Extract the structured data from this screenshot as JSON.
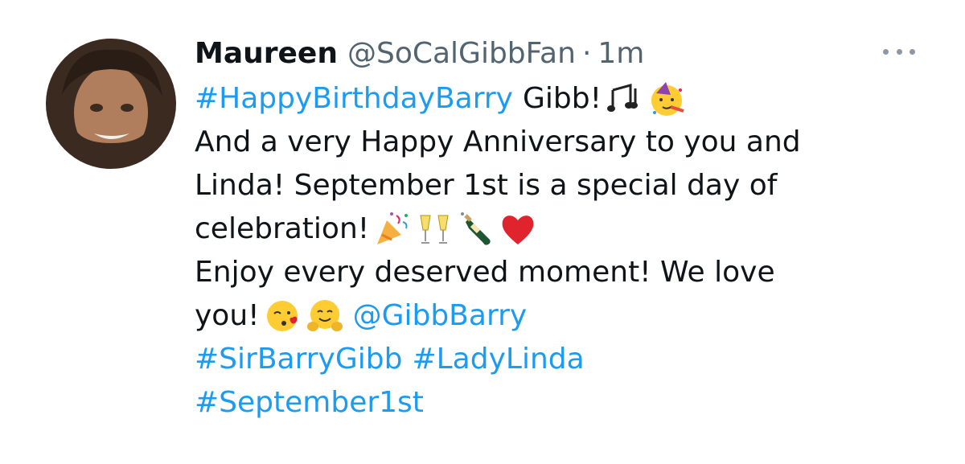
{
  "author": {
    "display_name": "Maureen",
    "handle": "@SoCalGibbFan",
    "separator": "·",
    "timestamp": "1m"
  },
  "tweet": {
    "line1": {
      "hashtag": "#HappyBirthdayBarry",
      "text": "Gibb!"
    },
    "line2": "And a very Happy Anniversary to you and",
    "line3": "Linda! September 1st is a special day of",
    "line4": "celebration!",
    "line5": "Enjoy every deserved moment! We love",
    "line6": {
      "text": "you!",
      "mention": "@GibbBarry"
    },
    "line7": {
      "hashtag1": "#SirBarryGibb",
      "hashtag2": "#LadyLinda"
    },
    "line8": {
      "hashtag": "#September1st"
    }
  },
  "icons": {
    "avatar": "profile-photo",
    "more": "more-options-icon",
    "line1_emoji": [
      "musical-notes-emoji",
      "partying-face-emoji"
    ],
    "line4_emoji": [
      "party-popper-emoji",
      "clinking-glasses-emoji",
      "champagne-bottle-emoji",
      "red-heart-emoji"
    ],
    "line6_emoji": [
      "face-blowing-kiss-emoji",
      "hugging-face-emoji"
    ]
  },
  "colors": {
    "link": "#1d9bf0",
    "text": "#0f1419",
    "secondary": "#536471",
    "more_dots": "#8b98a5"
  }
}
